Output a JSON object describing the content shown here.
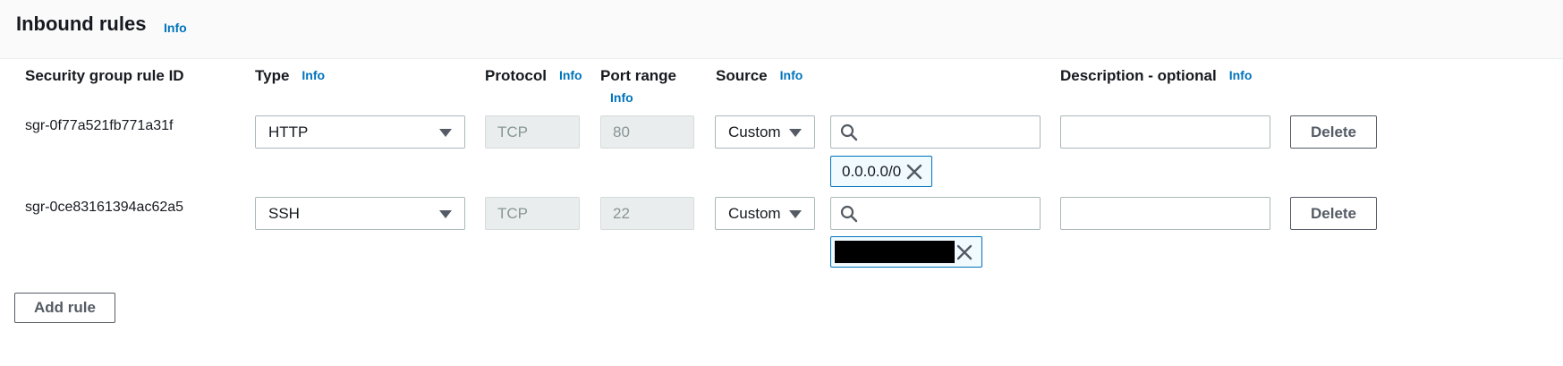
{
  "panel": {
    "title": "Inbound rules",
    "info": "Info"
  },
  "columns": {
    "rule_id": "Security group rule ID",
    "type": "Type",
    "type_info": "Info",
    "protocol": "Protocol",
    "protocol_info": "Info",
    "port_range": "Port range",
    "port_range_info": "Info",
    "source": "Source",
    "source_info": "Info",
    "description": "Description - optional",
    "description_info": "Info"
  },
  "rules": [
    {
      "id": "sgr-0f77a521fb771a31f",
      "type": "HTTP",
      "protocol": "TCP",
      "port": "80",
      "source": "Custom",
      "cidr": "0.0.0.0/0",
      "description": "",
      "delete_label": "Delete"
    },
    {
      "id": "sgr-0ce83161394ac62a5",
      "type": "SSH",
      "protocol": "TCP",
      "port": "22",
      "source": "Custom",
      "cidr": "",
      "description": "",
      "delete_label": "Delete"
    }
  ],
  "add_rule_label": "Add rule",
  "colors": {
    "info_link": "#0073bb",
    "token_border": "#0073bb",
    "token_bg": "#f1faff",
    "disabled_bg": "#eaeded"
  },
  "icons": {
    "search": "search-icon",
    "close": "close-icon",
    "caret": "caret-down-icon"
  }
}
